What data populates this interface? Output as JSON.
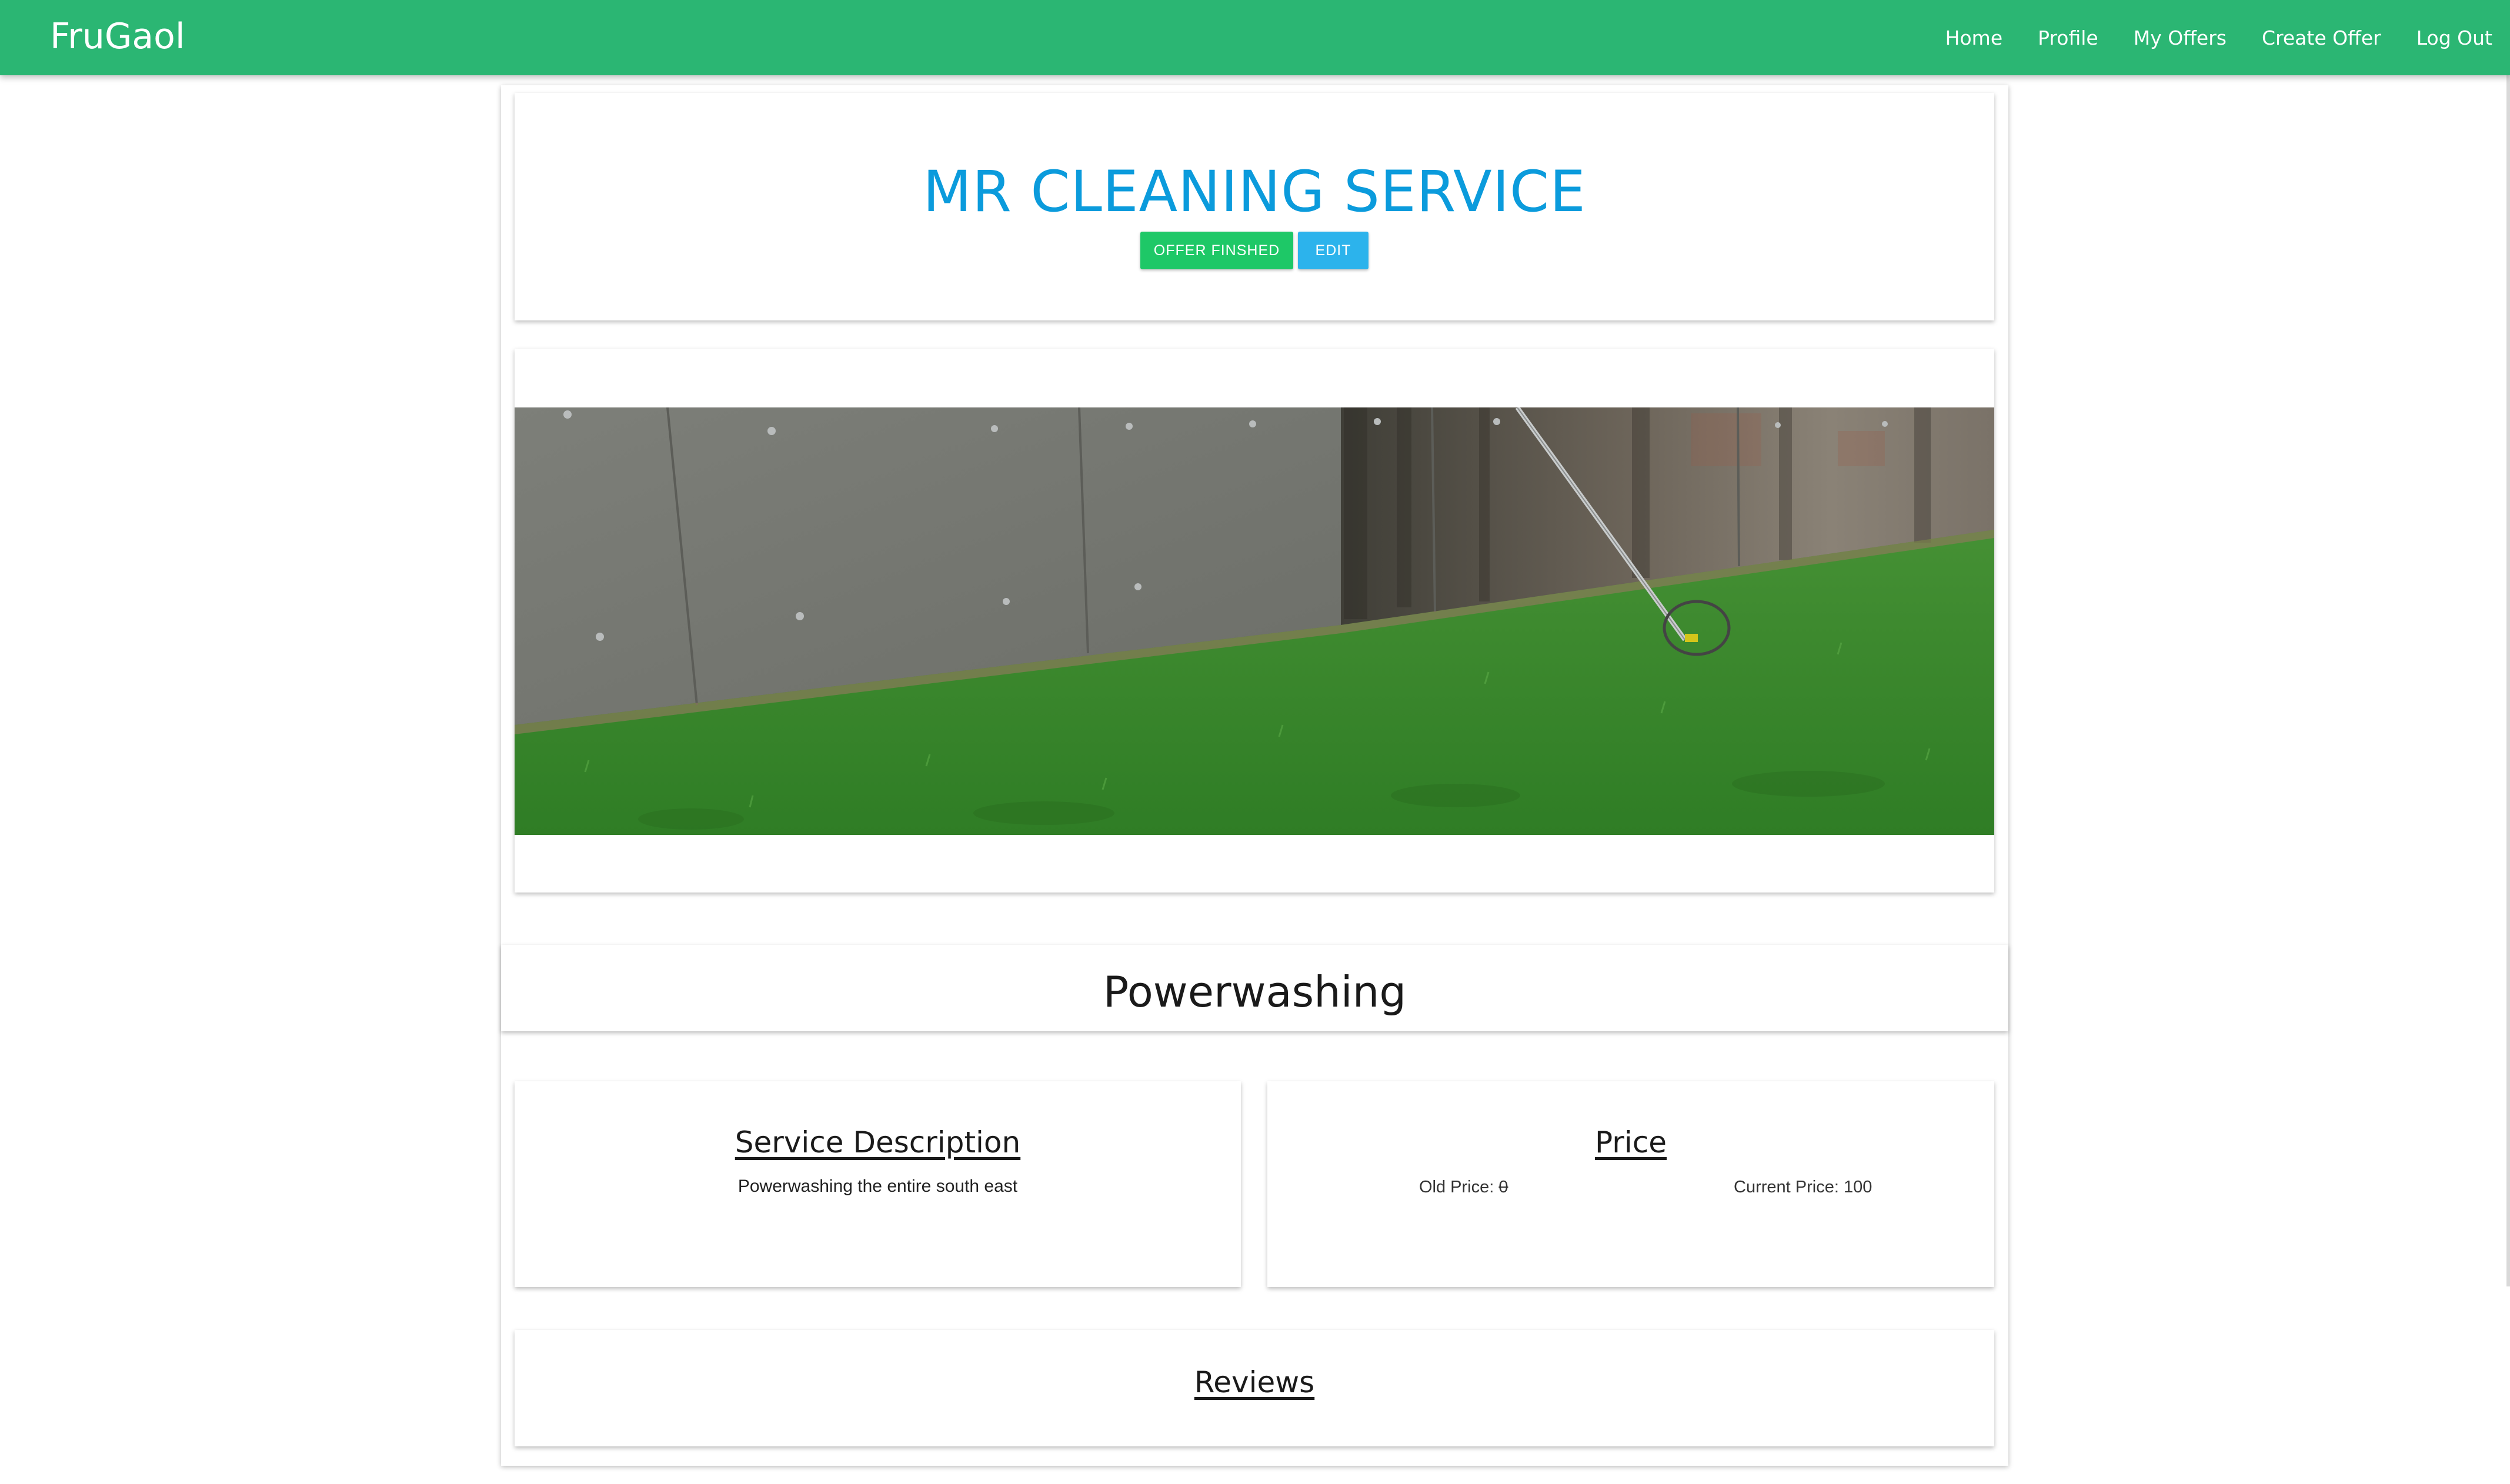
{
  "navbar": {
    "brand": "FruGaol",
    "links": [
      "Home",
      "Profile",
      "My Offers",
      "Create Offer",
      "Log Out"
    ]
  },
  "offer": {
    "title": "MR CLEANING SERVICE",
    "finish_button": "OFFER FINSHED",
    "edit_button": "EDIT",
    "image_description": "Concrete wall being power washed above green lawn",
    "category": "Powerwashing"
  },
  "description": {
    "heading": "Service Description",
    "text": "Powerwashing the entire south east"
  },
  "price": {
    "heading": "Price",
    "old_label": "Old Price: ",
    "old_value": "0",
    "current_label": "Current Price: ",
    "current_value": "100"
  },
  "reviews": {
    "heading": "Reviews"
  },
  "colors": {
    "navbar": "#2bb673",
    "title": "#0b9bdc",
    "finish_button": "#1ec867",
    "edit_button": "#2cb3ec"
  }
}
